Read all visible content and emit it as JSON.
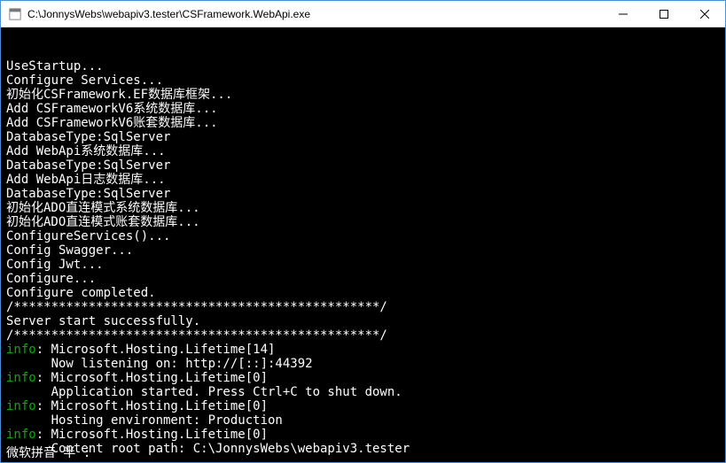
{
  "window": {
    "title": "C:\\JonnysWebs\\webapiv3.tester\\CSFramework.WebApi.exe"
  },
  "console": {
    "lines": [
      "UseStartup...",
      "Configure Services...",
      "初始化CSFramework.EF数据库框架...",
      "Add CSFrameworkV6系统数据库...",
      "Add CSFrameworkV6账套数据库...",
      "DatabaseType:SqlServer",
      "Add WebApi系统数据库...",
      "DatabaseType:SqlServer",
      "Add WebApi日志数据库...",
      "DatabaseType:SqlServer",
      "初始化ADO直连模式系统数据库...",
      "初始化ADO直连模式账套数据库...",
      "ConfigureServices()...",
      "Config Swagger...",
      "Config Jwt...",
      "Configure...",
      "Configure completed.",
      "/*************************************************/",
      "Server start successfully.",
      "/*************************************************/"
    ],
    "info_entries": [
      {
        "source": "Microsoft.Hosting.Lifetime[14]",
        "message": "Now listening on: http://[::]:44392"
      },
      {
        "source": "Microsoft.Hosting.Lifetime[0]",
        "message": "Application started. Press Ctrl+C to shut down."
      },
      {
        "source": "Microsoft.Hosting.Lifetime[0]",
        "message": "Hosting environment: Production"
      },
      {
        "source": "Microsoft.Hosting.Lifetime[0]",
        "message": "Content root path: C:\\JonnysWebs\\webapiv3.tester"
      }
    ],
    "info_label": "info",
    "info_sep": ": ",
    "msg_indent": "      "
  },
  "ime": {
    "text": "微软拼音 半 :"
  }
}
